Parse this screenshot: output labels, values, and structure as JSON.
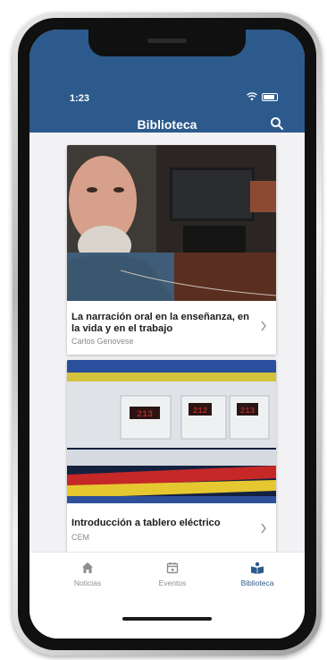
{
  "status_bar": {
    "time": "1:23"
  },
  "header": {
    "title": "Biblioteca"
  },
  "cards": [
    {
      "title": "La narración oral en la enseñanza, en la vida y en el trabajo",
      "author": "Carlos Genovese"
    },
    {
      "title": "Introducción a tablero eléctrico",
      "author": "CEM"
    }
  ],
  "tabs": [
    {
      "label": "Noticias",
      "icon": "home-icon"
    },
    {
      "label": "Eventos",
      "icon": "calendar-icon"
    },
    {
      "label": "Biblioteca",
      "icon": "library-icon",
      "active": true
    }
  ],
  "colors": {
    "primary": "#2c5a8c",
    "inactive": "#8e8e8e"
  }
}
